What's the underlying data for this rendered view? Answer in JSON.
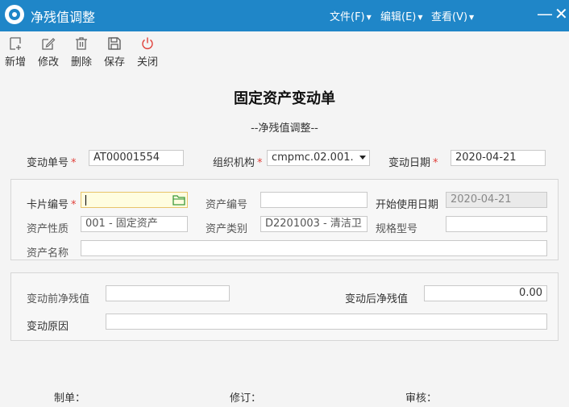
{
  "window": {
    "title": "净残值调整",
    "menu": [
      {
        "label": "文件(F)"
      },
      {
        "label": "编辑(E)"
      },
      {
        "label": "查看(V)"
      }
    ],
    "minimize": "—",
    "close": "✕"
  },
  "toolbar": {
    "items": [
      {
        "label": "新增",
        "icon": "add-icon"
      },
      {
        "label": "修改",
        "icon": "edit-icon"
      },
      {
        "label": "删除",
        "icon": "trash-icon"
      },
      {
        "label": "保存",
        "icon": "save-icon"
      },
      {
        "label": "关闭",
        "icon": "power-icon"
      }
    ]
  },
  "form": {
    "title": "固定资产变动单",
    "subtitle": "--净残值调整--",
    "header": {
      "change_no_label": "变动单号",
      "change_no_value": "AT00001554",
      "org_label": "组织机构",
      "org_value": "cmpmc.02.001.",
      "change_date_label": "变动日期",
      "change_date_value": "2020-04-21"
    },
    "asset": {
      "card_no_label": "卡片编号",
      "card_no_value": "",
      "asset_no_label": "资产编号",
      "asset_no_value": "",
      "start_date_label": "开始使用日期",
      "start_date_value": "2020-04-21",
      "nature_label": "资产性质",
      "nature_value": "001 - 固定资产",
      "category_label": "资产类别",
      "category_value": "D2201003 - 清洁卫",
      "spec_label": "规格型号",
      "spec_value": "",
      "name_label": "资产名称",
      "name_value": ""
    },
    "change": {
      "before_label": "变动前净残值",
      "before_value": "",
      "after_label": "变动后净残值",
      "after_value": "0.00",
      "reason_label": "变动原因",
      "reason_value": ""
    },
    "footer": {
      "maker_label": "制单：",
      "revise_label": "修订：",
      "audit_label": "审核："
    }
  },
  "colors": {
    "titlebar": "#1f86c8",
    "required": "#e0403a",
    "close_icon": "#e0403a",
    "folder_icon": "#3a9a3a"
  }
}
